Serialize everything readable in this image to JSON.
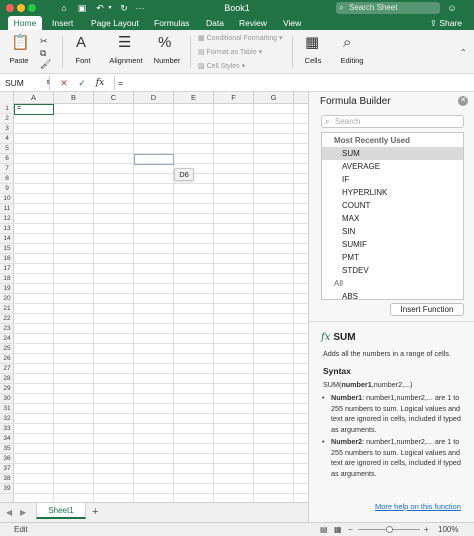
{
  "window": {
    "title": "Book1",
    "search_placeholder": "Search Sheet",
    "share_label": "Share"
  },
  "tabs": [
    "Home",
    "Insert",
    "Page Layout",
    "Formulas",
    "Data",
    "Review",
    "View"
  ],
  "ribbon": {
    "paste": "Paste",
    "font": "Font",
    "alignment": "Alignment",
    "number": "Number",
    "conditional_formatting": "Conditional Formatting",
    "format_as_table": "Format as Table",
    "cell_styles": "Cell Styles",
    "cells": "Cells",
    "editing": "Editing"
  },
  "formula_bar": {
    "name_box": "SUM",
    "fx_label": "fx",
    "formula": "="
  },
  "grid": {
    "columns": [
      "A",
      "B",
      "C",
      "D",
      "E",
      "F",
      "G"
    ],
    "rows": [
      "1",
      "2",
      "3",
      "4",
      "5",
      "6",
      "7",
      "8",
      "9",
      "10",
      "11",
      "12",
      "13",
      "14",
      "15",
      "16",
      "17",
      "18",
      "19",
      "20",
      "21",
      "22",
      "23",
      "24",
      "25",
      "26",
      "27",
      "28",
      "29",
      "30",
      "31",
      "32",
      "33",
      "34",
      "35",
      "36",
      "37",
      "38",
      "39"
    ],
    "active_cell_value": "=",
    "tooltip": "D6"
  },
  "sheets": {
    "tab": "Sheet1",
    "add": "+"
  },
  "status": {
    "mode": "Edit",
    "zoom": "100%",
    "zoom_minus": "−",
    "zoom_plus": "+"
  },
  "formula_builder": {
    "title": "Formula Builder",
    "search_placeholder": "Search",
    "list": [
      {
        "label": "Most Recently Used",
        "kind": "header"
      },
      {
        "label": "SUM",
        "kind": "selected"
      },
      {
        "label": "AVERAGE",
        "kind": "item"
      },
      {
        "label": "IF",
        "kind": "item"
      },
      {
        "label": "HYPERLINK",
        "kind": "item"
      },
      {
        "label": "COUNT",
        "kind": "item"
      },
      {
        "label": "MAX",
        "kind": "item"
      },
      {
        "label": "SIN",
        "kind": "item"
      },
      {
        "label": "SUMIF",
        "kind": "item"
      },
      {
        "label": "PMT",
        "kind": "item"
      },
      {
        "label": "STDEV",
        "kind": "item"
      },
      {
        "label": "All",
        "kind": "section"
      },
      {
        "label": "ABS",
        "kind": "item"
      }
    ],
    "insert_button": "Insert Function",
    "fx_symbol": "fx",
    "function_name": "SUM",
    "description": "Adds all the numbers in a range of cells.",
    "syntax_heading": "Syntax",
    "syntax_prefix": "SUM(",
    "syntax_bold": "number1",
    "syntax_suffix": ",number2,...)",
    "args": [
      {
        "name": "Number1",
        "text": ": number1,number2,... are 1 to 255 numbers to sum. Logical values and text are ignored in cells, included if typed as arguments."
      },
      {
        "name": "Number2",
        "text": ": number1,number2,... are 1 to 255 numbers to sum. Logical values and text are ignored in cells, included if typed as arguments."
      }
    ],
    "more_help": "More help on this function"
  }
}
